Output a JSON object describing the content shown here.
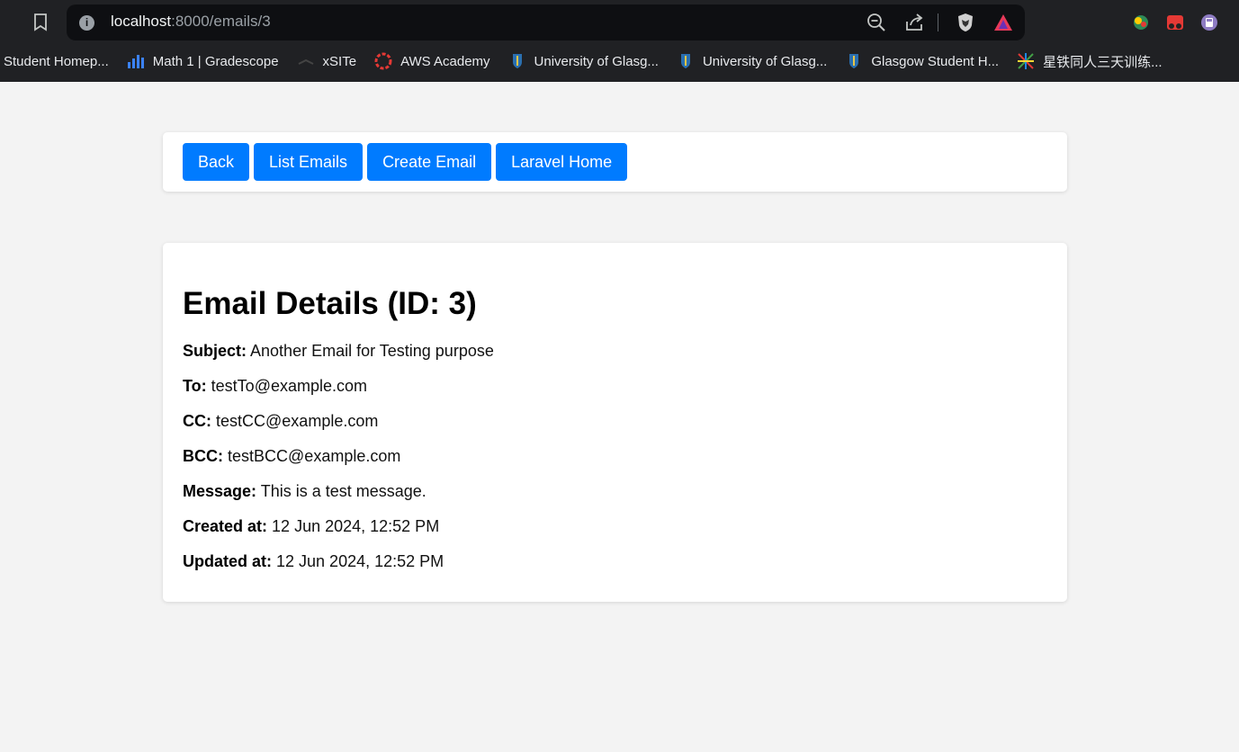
{
  "browser": {
    "url_host": "localhost",
    "url_path": ":8000/emails/3",
    "bookmarks": [
      {
        "label": "Student Homep...",
        "icon": "none"
      },
      {
        "label": "Math 1 | Gradescope",
        "icon": "gradescope-icon"
      },
      {
        "label": "xSITe",
        "icon": "xsite-icon"
      },
      {
        "label": "AWS Academy",
        "icon": "aws-academy-icon"
      },
      {
        "label": "University of Glasg...",
        "icon": "glasgow-crest-icon"
      },
      {
        "label": "University of Glasg...",
        "icon": "glasgow-crest-icon"
      },
      {
        "label": "Glasgow Student H...",
        "icon": "glasgow-crest-icon"
      },
      {
        "label": "星铁同人三天训练...",
        "icon": "colorful-burst-icon"
      }
    ]
  },
  "nav": {
    "back": "Back",
    "list_emails": "List Emails",
    "create_email": "Create Email",
    "laravel_home": "Laravel Home"
  },
  "detail": {
    "heading": "Email Details (ID: 3)",
    "fields": [
      {
        "label": "Subject:",
        "value": "Another Email for Testing purpose"
      },
      {
        "label": "To:",
        "value": "testTo@example.com"
      },
      {
        "label": "CC:",
        "value": "testCC@example.com"
      },
      {
        "label": "BCC:",
        "value": "testBCC@example.com"
      },
      {
        "label": "Message:",
        "value": "This is a test message."
      },
      {
        "label": "Created at:",
        "value": "12 Jun 2024, 12:52 PM"
      },
      {
        "label": "Updated at:",
        "value": "12 Jun 2024, 12:52 PM"
      }
    ]
  },
  "colors": {
    "primary_button": "#007bff",
    "page_background": "#f3f3f3",
    "chrome_background": "#202124"
  }
}
